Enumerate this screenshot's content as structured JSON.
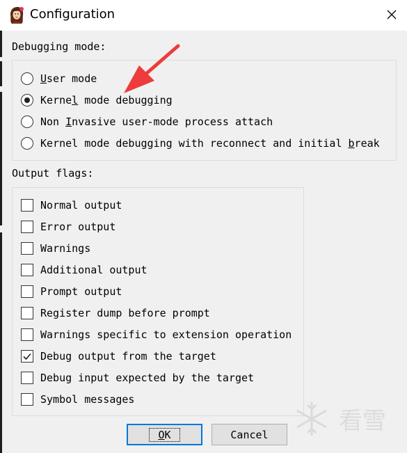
{
  "window": {
    "title": "Configuration",
    "icon": "app-portrait-icon",
    "close_icon": "close-icon"
  },
  "debugging_mode": {
    "label": "Debugging mode:",
    "options": [
      {
        "pre": "",
        "accel": "U",
        "post": "ser mode",
        "selected": false
      },
      {
        "pre": "Kerne",
        "accel": "l",
        "post": " mode debugging",
        "selected": true
      },
      {
        "pre": "Non ",
        "accel": "I",
        "post": "nvasive user-mode process attach",
        "selected": false
      },
      {
        "pre": "Kernel mode debugging with reconnect and initial ",
        "accel": "b",
        "post": "reak",
        "selected": false
      }
    ]
  },
  "output_flags": {
    "label": "Output flags:",
    "items": [
      {
        "label": "Normal output",
        "checked": false
      },
      {
        "label": "Error output",
        "checked": false
      },
      {
        "label": "Warnings",
        "checked": false
      },
      {
        "label": "Additional output",
        "checked": false
      },
      {
        "label": "Prompt output",
        "checked": false
      },
      {
        "label": "Register dump before prompt",
        "checked": false
      },
      {
        "label": "Warnings specific to extension operation",
        "checked": false
      },
      {
        "label": "Debug output from the target",
        "checked": true
      },
      {
        "label": "Debug input expected by the target",
        "checked": false
      },
      {
        "label": "Symbol messages",
        "checked": false
      }
    ]
  },
  "buttons": {
    "ok_accel": "O",
    "ok_rest": "K",
    "cancel": "Cancel"
  },
  "annotation": {
    "arrow_color": "#ee3b3b",
    "arrow_icon": "red-arrow-icon"
  },
  "watermark": {
    "text": "看雪",
    "icon": "snowflake-icon"
  },
  "colors": {
    "default_button_border": "#0078d7",
    "dialog_background": "#f0f0f0",
    "title_background": "#ffffff"
  }
}
